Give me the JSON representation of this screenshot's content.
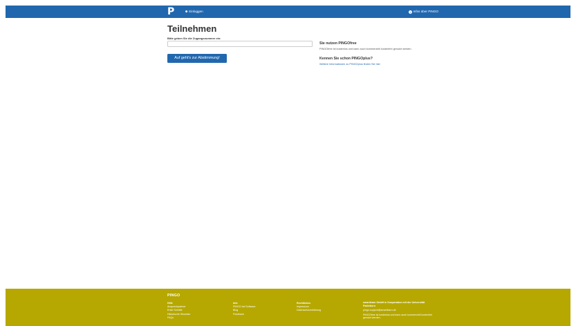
{
  "navbar": {
    "logo": "P",
    "login_label": "Einloggen",
    "info_label": "Infos über PINGO",
    "background": "#2167ae"
  },
  "main": {
    "title": "Teilnehmen",
    "field_label": "Bitte geben Sie die Zugangsnummer ein:",
    "input_value": "",
    "input_placeholder": "",
    "submit_label": "Auf geht's zur Abstimmung!"
  },
  "aside": {
    "heading": "Sie nutzen PINGOfree",
    "text": "PINGOfree ist kostenlos und kann auch kommerziell kostenfrei genutzt werden.",
    "heading2": "Kennen Sie schon PINGOplus?",
    "link": "Weitere Informationen zu PINGOplus finden Sie hier"
  },
  "footer": {
    "background": "#b6a800",
    "title": "PINGO",
    "col1": {
      "heading": "Hilfe",
      "links": [
        "Ansprechpartner",
        "Erste Schritte",
        "Historische Hinweise",
        "FAQs"
      ]
    },
    "col2": {
      "heading": "Info",
      "links": [
        "PINGO bei Software",
        "Blog",
        "Feedback"
      ]
    },
    "col3": {
      "heading": "Rechtliches",
      "links": [
        "Impressum",
        "Datenschutzerklärung"
      ]
    },
    "col4": {
      "heading": "smartlearn GmbH in Kooperation mit der Universität Paderborn",
      "email": "pingo-support@smartlearn.de",
      "text": "PINGOfree ist kostenlos und kann auch kommerziell kostenfrei genutzt werden."
    }
  }
}
